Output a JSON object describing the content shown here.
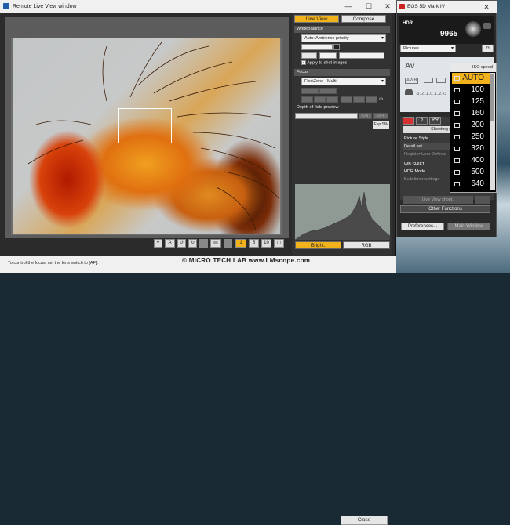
{
  "live_view_window": {
    "title": "Remote Live View window",
    "minimize": "—",
    "maximize": "☐",
    "close": "✕",
    "tabs": {
      "live_view": "Live View",
      "compose": "Compose"
    },
    "white_balance": {
      "section": "WhiteBalance",
      "mode": "Auto: Ambience priority",
      "apply_label": "Apply to shot images",
      "apply_checked": true
    },
    "focus": {
      "section": "Focus",
      "mode": "FlexiZone - Multi",
      "inf_label": "∞"
    },
    "dof": {
      "section": "Depth-of-field preview",
      "on": "ON",
      "off": "OFF",
      "exp_sim": "Exp.SIM"
    },
    "histogram": {
      "bright": "Bright.",
      "rgb": "RGB"
    },
    "status_text": "To control the focus, set the lens switch to [AF].",
    "close_button": "Close"
  },
  "watermark": "©  MICRO TECH LAB  www.LMscope.com",
  "eos_window": {
    "title": "EOS 5D Mark IV",
    "close": "✕",
    "hdr": "HDR",
    "shots_remaining": "9965",
    "picture_style_dd": "Pictures",
    "lcd": {
      "av": "Av",
      "awb": "AWB",
      "scale": "-3..2..1..0..1..2.+3"
    },
    "menu_items": [
      "Picture Style",
      "Detail set.",
      "Register User Defined",
      "WB SHIFT",
      "HDR Mode",
      "Bulb timer settings"
    ],
    "shooting_tab": "Shooting m",
    "live_view_shoot": "Live View shoot.",
    "other_functions": "Other Functions",
    "preferences_button": "Preferences...",
    "main_window_button": "Main Window"
  },
  "iso_popup": {
    "title": "ISO speed",
    "values": [
      "AUTO",
      "100",
      "125",
      "160",
      "200",
      "250",
      "320",
      "400",
      "500",
      "640"
    ],
    "selected": "AUTO"
  },
  "colors": {
    "accent": "#f2b21b"
  }
}
